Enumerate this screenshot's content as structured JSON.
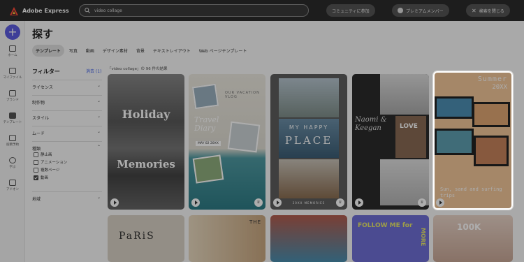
{
  "app": {
    "title": "Adobe Express"
  },
  "search": {
    "value": "video collage"
  },
  "header": {
    "community_label": "コミュニティに参加",
    "premium_label": "プレミアムメンバー",
    "close_search_label": "検索を閉じる"
  },
  "sidebar": {
    "items": [
      {
        "label": "ホーム",
        "icon": "home-icon"
      },
      {
        "label": "マイファイル",
        "icon": "folder-icon"
      },
      {
        "label": "ブランド",
        "icon": "brand-icon"
      },
      {
        "label": "テンプレート",
        "icon": "template-icon"
      },
      {
        "label": "投稿予約",
        "icon": "calendar-icon"
      },
      {
        "label": "学ぶ",
        "icon": "lightbulb-icon"
      },
      {
        "label": "アドオン",
        "icon": "addon-icon"
      }
    ]
  },
  "main": {
    "heading": "探す",
    "tabs": [
      "テンプレート",
      "写真",
      "動画",
      "デザイン素材",
      "背景",
      "テキストレイアウト",
      "Web ページテンプレート"
    ],
    "result_text": "「video collage」の 96 件の結果"
  },
  "filters": {
    "title": "フィルター",
    "clear_label": "消去 (1)",
    "sections": [
      "ライセンス",
      "制作物",
      "スタイル",
      "ムード",
      "種類",
      "地域"
    ],
    "type_options": [
      {
        "label": "静止画",
        "checked": false
      },
      {
        "label": "アニメーション",
        "checked": false
      },
      {
        "label": "複数ページ",
        "checked": false
      },
      {
        "label": "動画",
        "checked": true
      }
    ]
  },
  "cards": [
    {
      "line1": "Holiday",
      "line2": "Memories"
    },
    {
      "small": "OUR VACATION VLOG",
      "script": "Travel Diary",
      "date": "MAY 02 20XX"
    },
    {
      "title": "MY HAPPY",
      "big": "PLACE",
      "footer": "20XX MEMORIES"
    },
    {
      "names": "Naomi & Keegan",
      "badge": "LOVE"
    },
    {
      "title": "Summer",
      "sub": "20XX",
      "caption": "Sun, sand and surfing trips"
    },
    {
      "text": "PaRiS"
    },
    {
      "text": "THE"
    },
    {
      "text": ""
    },
    {
      "text": "FOLLOW ME for",
      "side": "MORE"
    },
    {
      "text": "100K"
    }
  ],
  "colors": {
    "accent": "#5c5ce0",
    "topbar": "#2c2c2c",
    "link": "#3c5ee8"
  }
}
